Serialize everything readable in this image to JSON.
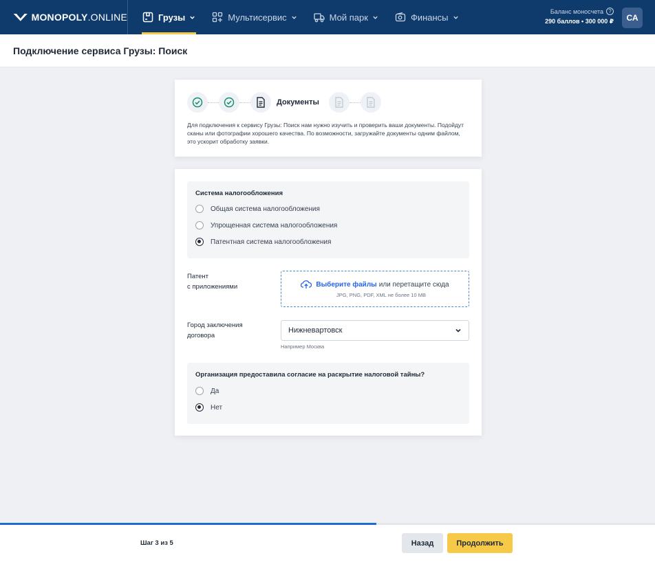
{
  "header": {
    "logo_bold": "MONOPOLY",
    "logo_light": ".ONLINE",
    "nav": [
      {
        "label": "Грузы",
        "icon": "cargo-box-icon",
        "active": true
      },
      {
        "label": "Мультисервис",
        "icon": "grid-plus-icon",
        "active": false
      },
      {
        "label": "Мой парк",
        "icon": "truck-icon",
        "active": false
      },
      {
        "label": "Финансы",
        "icon": "wallet-icon",
        "active": false
      }
    ],
    "balance_label": "Баланс моносчета",
    "balance_value": "290 баллов • 300 000 ₽",
    "avatar": "СА"
  },
  "page": {
    "title": "Подключение сервиса Грузы: Поиск"
  },
  "steps": {
    "current_label": "Документы",
    "description": "Для подключения к сервису Грузы: Поиск нам нужно изучить и проверить ваши документы. Подойдут сканы или фотографии хорошего качества. По возможности, загружайте документы одним файлом, это ускорит обработку заявки."
  },
  "form": {
    "tax": {
      "title": "Система налогообложения",
      "options": [
        {
          "label": "Общая система налогообложения",
          "checked": false
        },
        {
          "label": "Упрощенная система налогообложения",
          "checked": false
        },
        {
          "label": "Патентная система налогообложения",
          "checked": true
        }
      ]
    },
    "patent": {
      "label_line1": "Патент",
      "label_line2": "с приложениями",
      "link": "Выберите файлы",
      "text": "или перетащите сюда",
      "hint": "JPG, PNG, PDF, XML не более 10 MB"
    },
    "city": {
      "label_line1": "Город заключения",
      "label_line2": "договора",
      "value": "Нижневартовск",
      "hint": "Например Москва"
    },
    "secret": {
      "title": "Организация предоставила согласие на раскрытие налоговой тайны?",
      "options": [
        {
          "label": "Да",
          "checked": false
        },
        {
          "label": "Нет",
          "checked": true
        }
      ]
    }
  },
  "footer": {
    "step_counter": "Шаг 3 из 5",
    "progress": 0.575,
    "back_label": "Назад",
    "next_label": "Продолжить"
  },
  "colors": {
    "header_bg": "#0e3a6c",
    "accent_yellow": "#f7c948",
    "accent_blue": "#1e6ad1",
    "check_green": "#0f8a6a"
  }
}
